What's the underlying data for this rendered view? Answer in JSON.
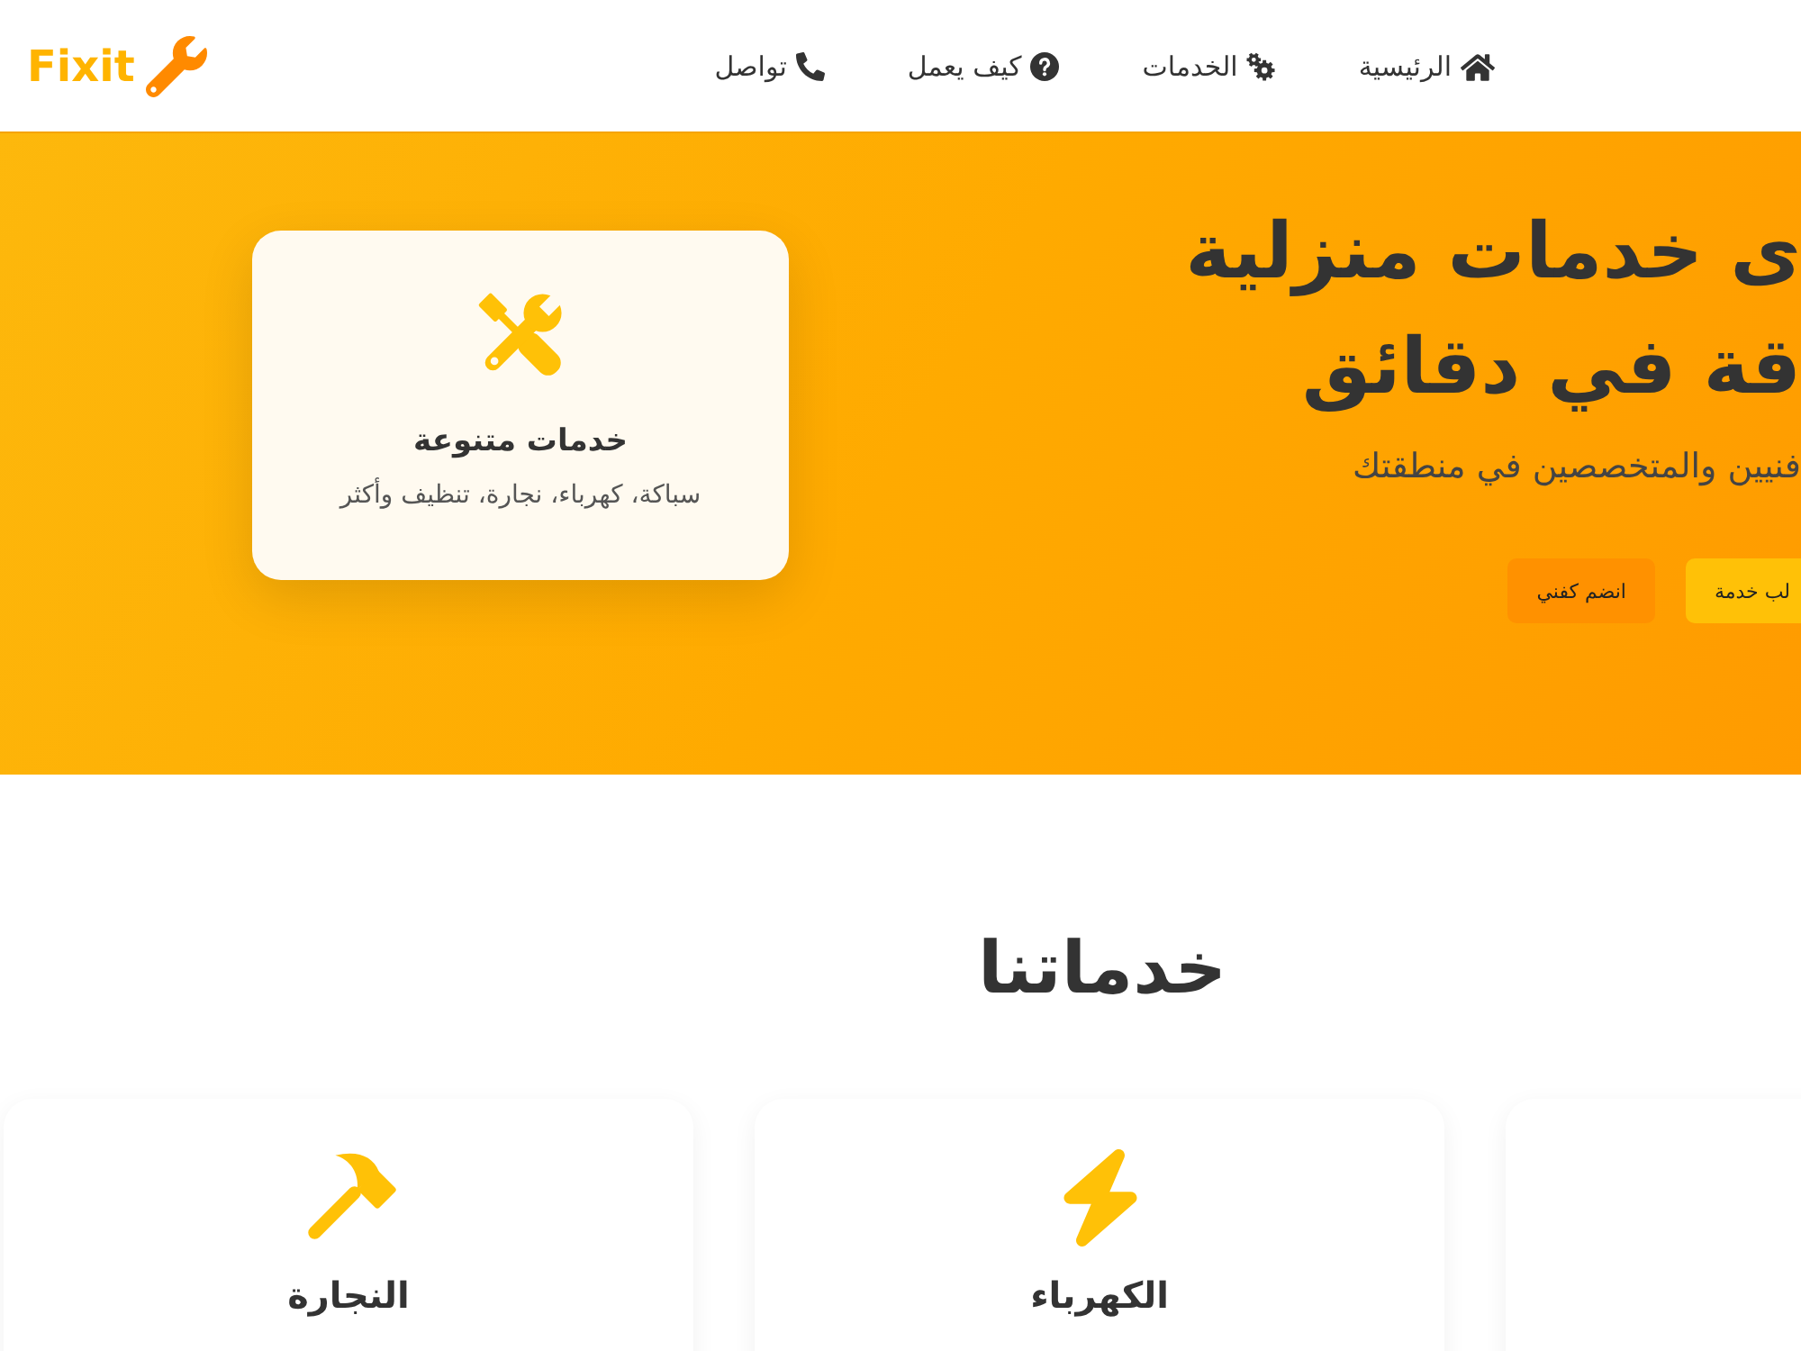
{
  "header": {
    "logo": "Fixit",
    "nav": [
      {
        "label": "الرئيسية"
      },
      {
        "label": "الخدمات"
      },
      {
        "label": "كيف يعمل"
      },
      {
        "label": "تواصل"
      }
    ]
  },
  "hero": {
    "title_lines": [
      "ى خدمات منزلية",
      "قة في دقائق"
    ],
    "subtitle": "فنيين والمتخصصين في منطقتك",
    "buttons": [
      {
        "kind": "primary",
        "label": "لب خدمة"
      },
      {
        "kind": "secondary",
        "label": "انضم كفني"
      }
    ],
    "feature_card": {
      "title": "خدمات متنوعة",
      "text": "سباكة، كهرباء، نجارة، تنظيف وأكثر"
    }
  },
  "services": {
    "title": "خدماتنا",
    "cards": [
      {
        "title": "الكهرباء"
      },
      {
        "title": "النجارة"
      }
    ]
  }
}
